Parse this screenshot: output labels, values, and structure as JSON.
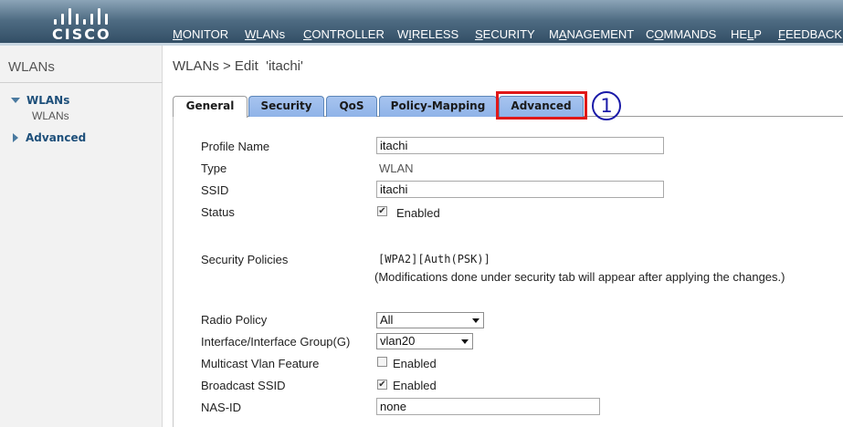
{
  "brand": {
    "logo_text": "CISCO"
  },
  "nav": [
    {
      "pre": "",
      "u": "M",
      "post": "ONITOR"
    },
    {
      "pre": "",
      "u": "W",
      "post": "LANs"
    },
    {
      "pre": "",
      "u": "C",
      "post": "ONTROLLER"
    },
    {
      "pre": "W",
      "u": "I",
      "post": "RELESS"
    },
    {
      "pre": "",
      "u": "S",
      "post": "ECURITY"
    },
    {
      "pre": "M",
      "u": "A",
      "post": "NAGEMENT"
    },
    {
      "pre": "C",
      "u": "O",
      "post": "MMANDS"
    },
    {
      "pre": "HE",
      "u": "L",
      "post": "P"
    },
    {
      "pre": "",
      "u": "F",
      "post": "EEDBACK"
    }
  ],
  "sidebar": {
    "title": "WLANs",
    "group_label": "WLANs",
    "group_sub": "WLANs",
    "advanced_label": "Advanced"
  },
  "page": {
    "title": "WLANs > Edit  'itachi'"
  },
  "tabs": [
    "General",
    "Security",
    "QoS",
    "Policy-Mapping",
    "Advanced"
  ],
  "annotation": {
    "step": "1",
    "highlight_color": "#e01818",
    "step_color": "#1a1aa8"
  },
  "form": {
    "profile_name_label": "Profile Name",
    "profile_name_value": "itachi",
    "type_label": "Type",
    "type_value": "WLAN",
    "ssid_label": "SSID",
    "ssid_value": "itachi",
    "status_label": "Status",
    "status_checked": true,
    "status_text": "Enabled",
    "security_policies_label": "Security Policies",
    "security_policies_value": "[WPA2][Auth(PSK)]",
    "security_policies_note": "(Modifications done under security tab will appear after applying the changes.)",
    "radio_policy_label": "Radio Policy",
    "radio_policy_value": "All",
    "interface_label": "Interface/Interface Group(G)",
    "interface_value": "vlan20",
    "multicast_label": "Multicast Vlan Feature",
    "multicast_checked": false,
    "multicast_text": "Enabled",
    "broadcast_label": "Broadcast SSID",
    "broadcast_checked": true,
    "broadcast_text": "Enabled",
    "nas_id_label": "NAS-ID",
    "nas_id_value": "none"
  }
}
